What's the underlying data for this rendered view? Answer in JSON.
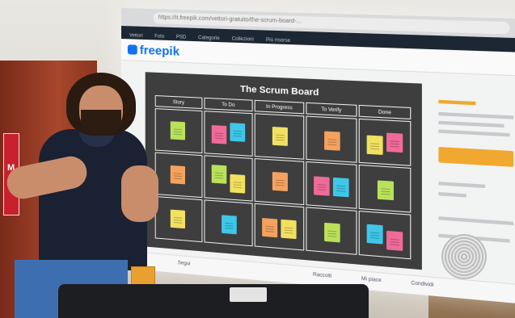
{
  "browser": {
    "url": "https://it.freepik.com/vettori-gratuito/the-scrum-board-..."
  },
  "site": {
    "logo": "freepik",
    "nav_items": [
      "Vettori",
      "Foto",
      "PSD",
      "Categorie",
      "Collezioni",
      "Più risorse"
    ]
  },
  "board": {
    "title": "The Scrum Board",
    "columns": [
      "Story",
      "To Do",
      "In Progress",
      "To Verify",
      "Done"
    ]
  },
  "bottom_bar": {
    "items": [
      "Segui",
      "Raccolti",
      "Mi piace",
      "Condividi"
    ]
  },
  "colors": {
    "note_green": "#b9e25a",
    "note_pink": "#f06a9a",
    "note_blue": "#3ec7e8",
    "note_yellow": "#f2e060",
    "note_orange": "#f4a25e",
    "freepik_blue": "#1273eb",
    "download_orange": "#f0a830"
  }
}
